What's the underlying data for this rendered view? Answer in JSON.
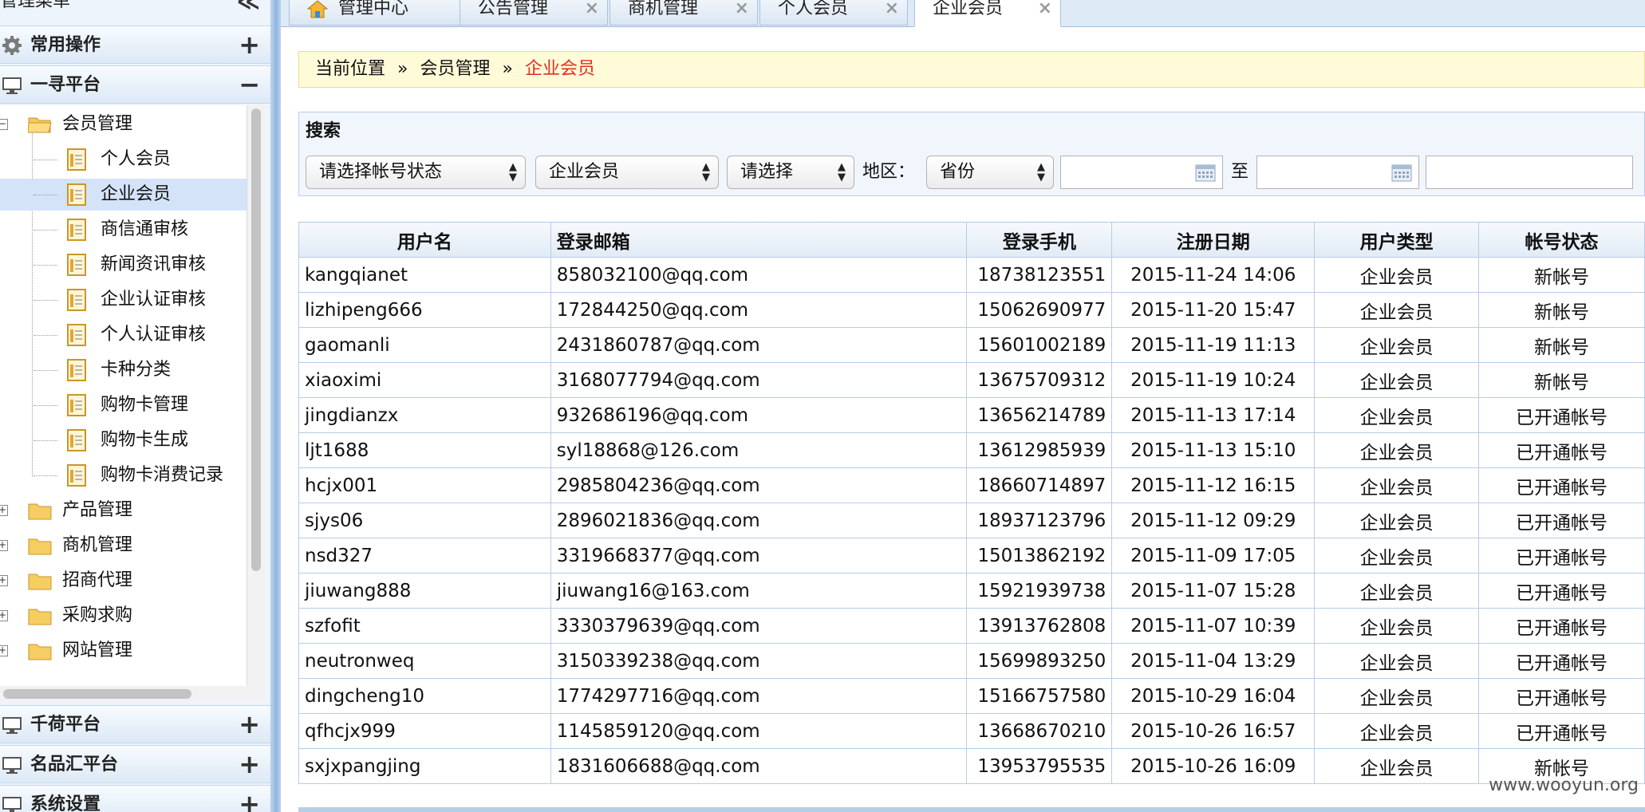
{
  "sidebar": {
    "title": "管理菜单",
    "collapse_symbol": "≪",
    "sections": [
      {
        "label": "常用操作",
        "toggle": "+"
      },
      {
        "label": "一寻平台",
        "toggle": "−"
      },
      {
        "label": "千荷平台",
        "toggle": "+"
      },
      {
        "label": "名品汇平台",
        "toggle": "+"
      },
      {
        "label": "系统设置",
        "toggle": "+"
      }
    ],
    "tree": {
      "root": "会员管理",
      "children": [
        "个人会员",
        "企业会员",
        "商信通审核",
        "新闻资讯审核",
        "企业认证审核",
        "个人认证审核",
        "卡种分类",
        "购物卡管理",
        "购物卡生成",
        "购物卡消费记录"
      ],
      "folders": [
        "产品管理",
        "商机管理",
        "招商代理",
        "采购求购",
        "网站管理"
      ]
    }
  },
  "tabs": [
    {
      "label": "管理中心"
    },
    {
      "label": "公告管理",
      "close": "×"
    },
    {
      "label": "商机管理",
      "close": "×"
    },
    {
      "label": "个人会员",
      "close": "×"
    },
    {
      "label": "企业会员",
      "close": "×"
    }
  ],
  "breadcrumb": {
    "prefix": "当前位置",
    "sep": "»",
    "parent": "会员管理",
    "current": "企业会员"
  },
  "search": {
    "title": "搜索",
    "account_status": "请选择帐号状态",
    "member_type": "企业会员",
    "choose": "请选择",
    "region_label": "地区：",
    "province": "省份",
    "to_label": "至"
  },
  "table": {
    "headers": [
      "用户名",
      "登录邮箱",
      "登录手机",
      "注册日期",
      "用户类型",
      "帐号状态"
    ],
    "rows": [
      [
        "kangqianet",
        "858032100@qq.com",
        "18738123551",
        "2015-11-24 14:06",
        "企业会员",
        "新帐号"
      ],
      [
        "lizhipeng666",
        "172844250@qq.com",
        "15062690977",
        "2015-11-20 15:47",
        "企业会员",
        "新帐号"
      ],
      [
        "gaomanli",
        "2431860787@qq.com",
        "15601002189",
        "2015-11-19 11:13",
        "企业会员",
        "新帐号"
      ],
      [
        "xiaoximi",
        "3168077794@qq.com",
        "13675709312",
        "2015-11-19 10:24",
        "企业会员",
        "新帐号"
      ],
      [
        "jingdianzx",
        "932686196@qq.com",
        "13656214789",
        "2015-11-13 17:14",
        "企业会员",
        "已开通帐号"
      ],
      [
        "ljt1688",
        "syl18868@126.com",
        "13612985939",
        "2015-11-13 15:10",
        "企业会员",
        "已开通帐号"
      ],
      [
        "hcjx001",
        "2985804236@qq.com",
        "18660714897",
        "2015-11-12 16:15",
        "企业会员",
        "已开通帐号"
      ],
      [
        "sjys06",
        "2896021836@qq.com",
        "18937123796",
        "2015-11-12 09:29",
        "企业会员",
        "已开通帐号"
      ],
      [
        "nsd327",
        "3319668377@qq.com",
        "15013862192",
        "2015-11-09 17:05",
        "企业会员",
        "已开通帐号"
      ],
      [
        "jiuwang888",
        "jiuwang16@163.com",
        "15921939738",
        "2015-11-07 15:28",
        "企业会员",
        "已开通帐号"
      ],
      [
        "szfofit",
        "3330379639@qq.com",
        "13913762808",
        "2015-11-07 10:39",
        "企业会员",
        "已开通帐号"
      ],
      [
        "neutronweq",
        "3150339238@qq.com",
        "15699893250",
        "2015-11-04 13:29",
        "企业会员",
        "已开通帐号"
      ],
      [
        "dingcheng10",
        "1774297716@qq.com",
        "15166757580",
        "2015-10-29 16:04",
        "企业会员",
        "已开通帐号"
      ],
      [
        "qfhcjx999",
        "1145859120@qq.com",
        "13668670210",
        "2015-10-26 16:57",
        "企业会员",
        "已开通帐号"
      ],
      [
        "sxjxpangjing",
        "1831606688@qq.com",
        "13953795535",
        "2015-10-26 16:09",
        "企业会员",
        "新帐号"
      ]
    ]
  },
  "watermark": "www.wooyun.org",
  "colors": {
    "accent_red": "#e0301e",
    "breadcrumb_bg": "#fffbd9",
    "grid_border": "#b6cde6"
  }
}
